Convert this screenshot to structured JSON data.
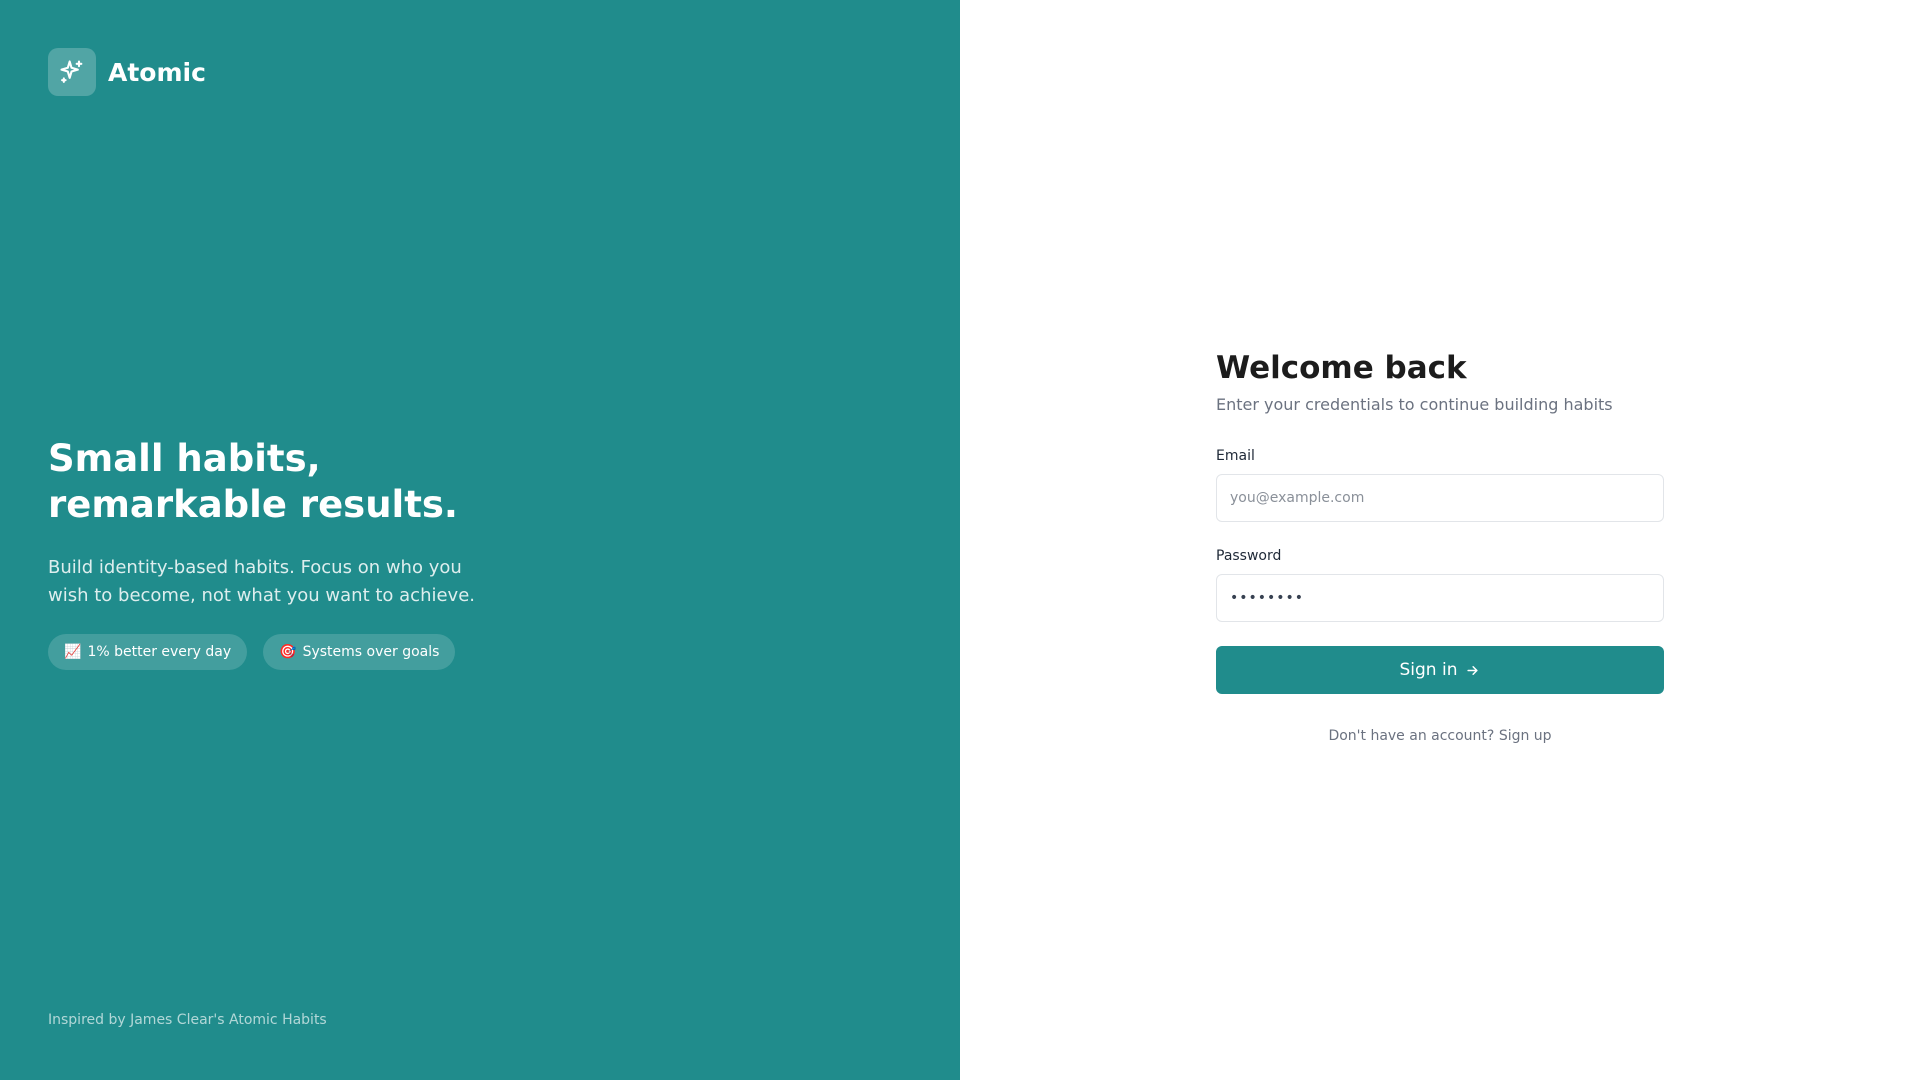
{
  "brand": {
    "name": "Atomic",
    "logo_icon": "sparkles-icon"
  },
  "hero": {
    "title_line1": "Small habits,",
    "title_line2": "remarkable results.",
    "subtitle": "Build identity-based habits. Focus on who you wish to become, not what you want to achieve.",
    "pills": [
      {
        "emoji": "📈",
        "label": "1% better every day"
      },
      {
        "emoji": "🎯",
        "label": "Systems over goals"
      }
    ]
  },
  "footer": {
    "note": "Inspired by James Clear's Atomic Habits"
  },
  "login": {
    "title": "Welcome back",
    "subtitle": "Enter your credentials to continue building habits",
    "email_label": "Email",
    "email_placeholder": "you@example.com",
    "email_value": "",
    "password_label": "Password",
    "password_value": "••••••••",
    "submit_label": "Sign in",
    "submit_icon": "arrow-right-icon",
    "signup_prompt": "Don't have an account?",
    "signup_link": "Sign up"
  },
  "colors": {
    "accent": "#208c8c",
    "background": "#ffffff",
    "muted_text": "#6b7280"
  }
}
